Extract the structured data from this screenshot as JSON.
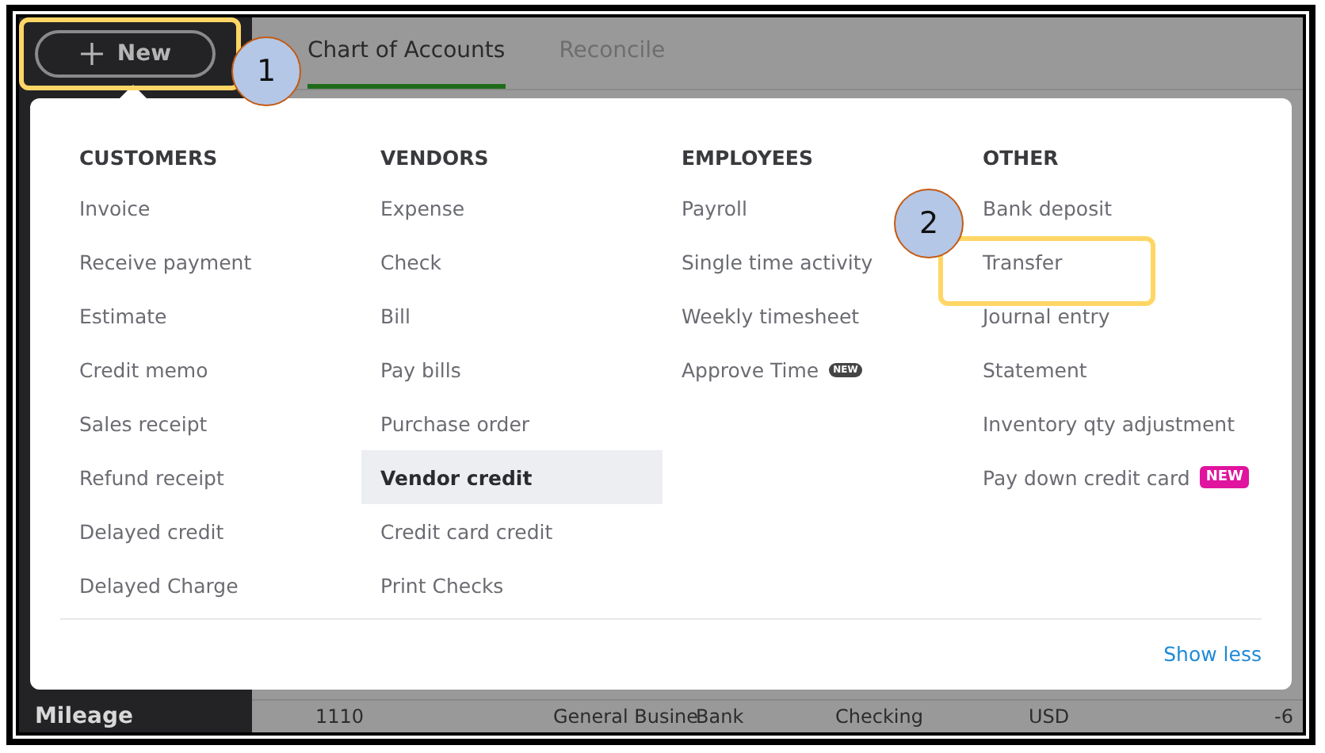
{
  "new_button": {
    "label": "New"
  },
  "tabs": [
    {
      "label": "Chart of Accounts",
      "selected": true
    },
    {
      "label": "Reconcile",
      "selected": false
    }
  ],
  "menu": {
    "columns": [
      {
        "heading": "CUSTOMERS",
        "items": [
          {
            "label": "Invoice",
            "selected": false
          },
          {
            "label": "Receive payment",
            "selected": false
          },
          {
            "label": "Estimate",
            "selected": false
          },
          {
            "label": "Credit memo",
            "selected": false
          },
          {
            "label": "Sales receipt",
            "selected": false
          },
          {
            "label": "Refund receipt",
            "selected": false
          },
          {
            "label": "Delayed credit",
            "selected": false
          },
          {
            "label": "Delayed Charge",
            "selected": false
          }
        ]
      },
      {
        "heading": "VENDORS",
        "items": [
          {
            "label": "Expense",
            "selected": false
          },
          {
            "label": "Check",
            "selected": false
          },
          {
            "label": "Bill",
            "selected": false
          },
          {
            "label": "Pay bills",
            "selected": false
          },
          {
            "label": "Purchase order",
            "selected": false
          },
          {
            "label": "Vendor credit",
            "selected": true
          },
          {
            "label": "Credit card credit",
            "selected": false
          },
          {
            "label": "Print Checks",
            "selected": false
          }
        ]
      },
      {
        "heading": "EMPLOYEES",
        "items": [
          {
            "label": "Payroll",
            "selected": false
          },
          {
            "label": "Single time activity",
            "selected": false
          },
          {
            "label": "Weekly timesheet",
            "selected": false
          },
          {
            "label": "Approve Time",
            "selected": false,
            "badge": {
              "text": "NEW",
              "kind": "dark"
            }
          }
        ]
      },
      {
        "heading": "OTHER",
        "items": [
          {
            "label": "Bank deposit",
            "selected": false
          },
          {
            "label": "Transfer",
            "selected": false
          },
          {
            "label": "Journal entry",
            "selected": false
          },
          {
            "label": "Statement",
            "selected": false
          },
          {
            "label": "Inventory qty adjustment",
            "selected": false
          },
          {
            "label": "Pay down credit card",
            "selected": false,
            "badge": {
              "text": "NEW",
              "kind": "pink"
            }
          }
        ]
      }
    ],
    "footer_link": "Show less"
  },
  "background_row": [
    "Mileage",
    "1110",
    "General Busine",
    "Bank",
    "Checking",
    "USD",
    "-6"
  ],
  "callouts": [
    {
      "number": "1"
    },
    {
      "number": "2"
    }
  ]
}
